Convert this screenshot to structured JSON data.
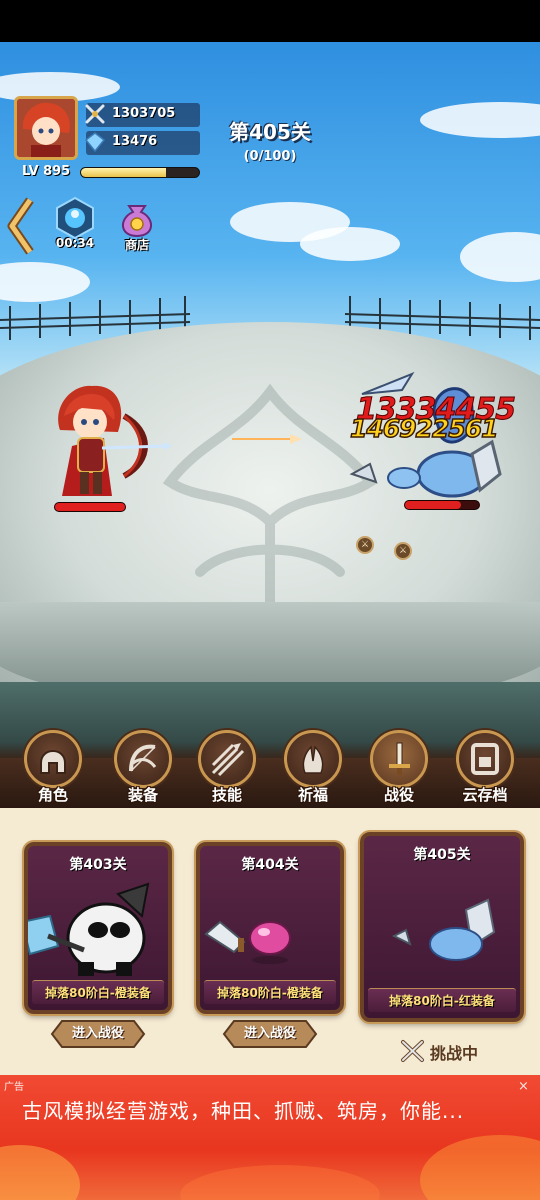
{
  "player": {
    "combat_power": "1303705",
    "gems": "13476",
    "level_label": "LV",
    "level": "895",
    "exp_progress": 0.72
  },
  "stage": {
    "title": "第405关",
    "progress": "(0/100)"
  },
  "hud_buttons": {
    "timer_label": "00:34",
    "shop_label": "商店"
  },
  "battle": {
    "damage_red": "13334455",
    "damage_yellow": "146922561",
    "hero_hp": 1.0,
    "enemy_hp": 0.75
  },
  "menu": [
    {
      "label": "角色",
      "icon": "helmet-icon"
    },
    {
      "label": "装备",
      "icon": "bow-icon"
    },
    {
      "label": "技能",
      "icon": "arrows-icon"
    },
    {
      "label": "祈福",
      "icon": "pray-hands-icon"
    },
    {
      "label": "战役",
      "icon": "sword-icon",
      "active": true
    },
    {
      "label": "云存档",
      "icon": "cloud-save-icon"
    }
  ],
  "stages": [
    {
      "title": "第403关",
      "drop": "掉落80阶白-橙装备",
      "button": "进入战役"
    },
    {
      "title": "第404关",
      "drop": "掉落80阶白-橙装备",
      "button": "进入战役"
    },
    {
      "title": "第405关",
      "drop": "掉落80阶白-红装备",
      "status": "挑战中"
    }
  ],
  "ad": {
    "label": "广告",
    "close": "×",
    "text": "古风模拟经营游戏，种田、抓贼、筑房，你能..."
  },
  "colors": {
    "hp_red": "#e01f1f",
    "card_bg": "#4a1d3c",
    "frame_gold": "#c9974f",
    "ad_red": "#e8361f"
  }
}
